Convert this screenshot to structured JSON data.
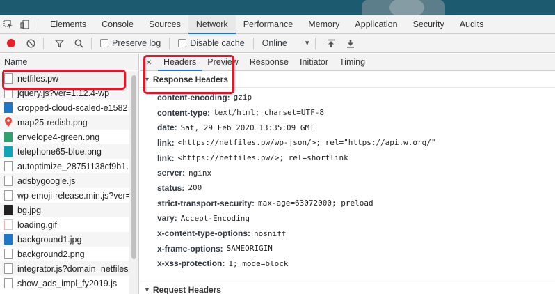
{
  "devtools": {
    "tabs": [
      "Elements",
      "Console",
      "Sources",
      "Network",
      "Performance",
      "Memory",
      "Application",
      "Security",
      "Audits"
    ],
    "active_tab": "Network"
  },
  "toolbar": {
    "preserve_log": "Preserve log",
    "disable_cache": "Disable cache",
    "throttle": "Online"
  },
  "requests": {
    "header": "Name",
    "items": [
      "netfiles.pw",
      "jquery.js?ver=1.12.4-wp",
      "cropped-cloud-scaled-e1582…",
      "map25-redish.png",
      "envelope4-green.png",
      "telephone65-blue.png",
      "autoptimize_28751138cf9b1…",
      "adsbygoogle.js",
      "wp-emoji-release.min.js?ver=",
      "bg.jpg",
      "loading.gif",
      "background1.jpg",
      "background2.png",
      "integrator.js?domain=netfiles.",
      "show_ads_impl_fy2019.js"
    ]
  },
  "detail": {
    "close": "×",
    "tabs": [
      "Headers",
      "Preview",
      "Response",
      "Initiator",
      "Timing"
    ],
    "active_tab": "Headers",
    "response_section": "Response Headers",
    "request_section": "Request Headers",
    "headers": [
      {
        "key": "content-encoding:",
        "value": "gzip"
      },
      {
        "key": "content-type:",
        "value": "text/html; charset=UTF-8"
      },
      {
        "key": "date:",
        "value": "Sat, 29 Feb 2020 13:35:09 GMT"
      },
      {
        "key": "link:",
        "value": "<https://netfiles.pw/wp-json/>; rel=\"https://api.w.org/\""
      },
      {
        "key": "link:",
        "value": "<https://netfiles.pw/>; rel=shortlink"
      },
      {
        "key": "server:",
        "value": "nginx"
      },
      {
        "key": "status:",
        "value": "200"
      },
      {
        "key": "strict-transport-security:",
        "value": "max-age=63072000; preload"
      },
      {
        "key": "vary:",
        "value": "Accept-Encoding"
      },
      {
        "key": "x-content-type-options:",
        "value": "nosniff"
      },
      {
        "key": "x-frame-options:",
        "value": "SAMEORIGIN"
      },
      {
        "key": "x-xss-protection:",
        "value": "1; mode=block"
      }
    ]
  },
  "colors": {
    "record": "#e8202a",
    "active_underline": "#1a73e8",
    "highlight": "#e0182a"
  }
}
